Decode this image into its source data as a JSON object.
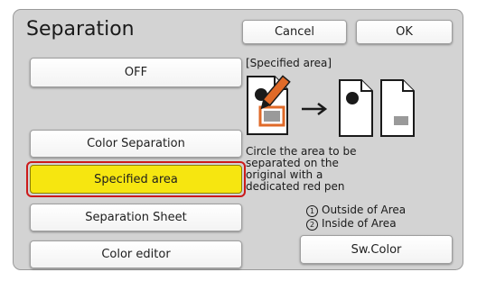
{
  "dialog": {
    "title": "Separation",
    "cancel_label": "Cancel",
    "ok_label": "OK"
  },
  "options": [
    {
      "label": "OFF",
      "selected": false
    },
    {
      "label": "Color Separation",
      "selected": false
    },
    {
      "label": "Specified area",
      "selected": true
    },
    {
      "label": "Separation Sheet",
      "selected": false
    },
    {
      "label": "Color editor",
      "selected": false
    }
  ],
  "detail": {
    "heading": "[Specified area]",
    "illustration_icon": "pen-marked-original-to-separated-pages",
    "description_lines": [
      "Circle the area to be",
      "separated on the",
      "original with a",
      "dedicated red pen"
    ],
    "legend": [
      {
        "number": "1",
        "text": "Outside of Area"
      },
      {
        "number": "2",
        "text": "Inside of Area"
      }
    ],
    "sw_color_label": "Sw.Color"
  },
  "colors": {
    "selected_fill": "#f6e610",
    "selection_ring": "#cc1a1a",
    "panel_background": "#d3d3d3"
  }
}
